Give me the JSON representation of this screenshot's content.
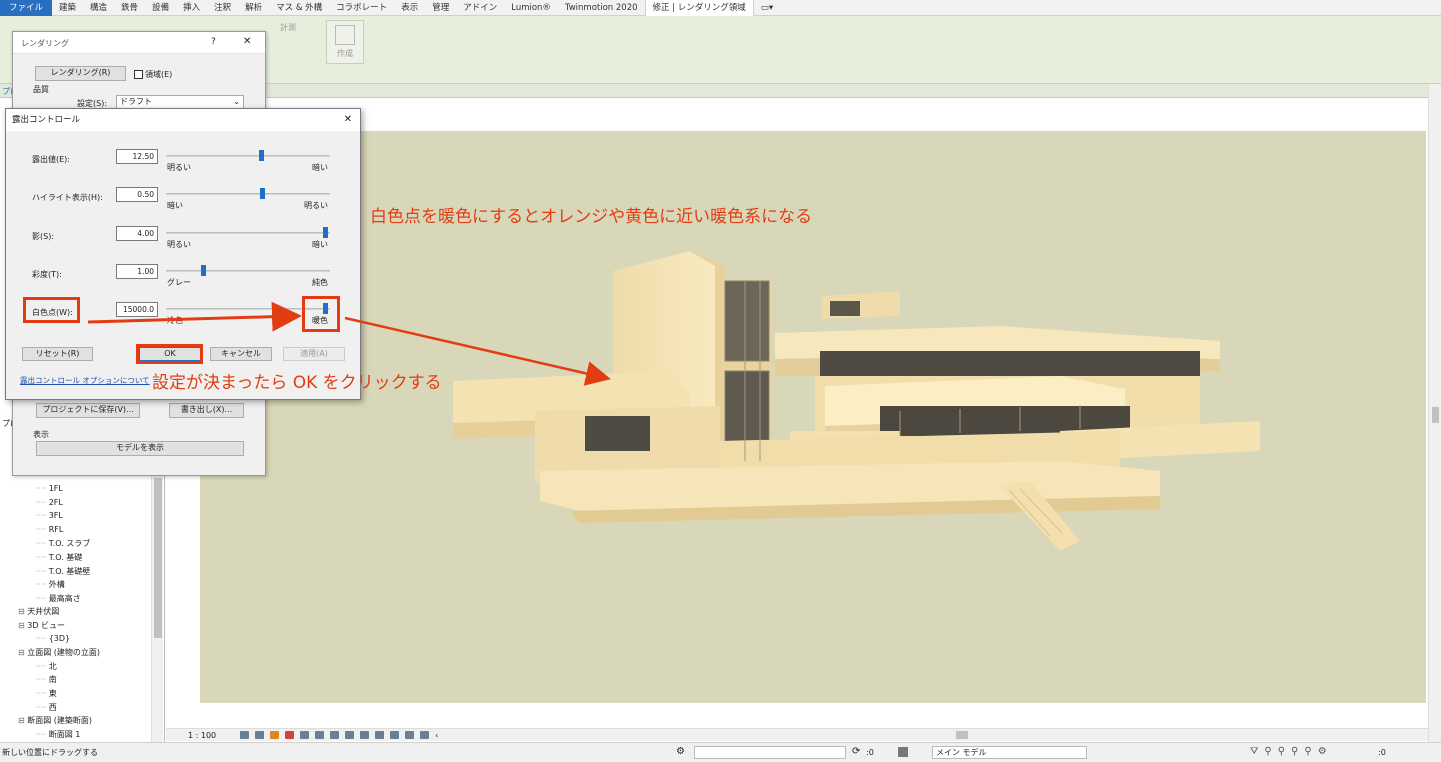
{
  "menubar": {
    "items": [
      "ファイル",
      "建築",
      "構造",
      "鉄骨",
      "設備",
      "挿入",
      "注釈",
      "解析",
      "マス & 外構",
      "コラボレート",
      "表示",
      "管理",
      "アドイン",
      "Lumion®",
      "Twinmotion 2020",
      "修正 | レンダリング領域"
    ],
    "extra": "▭▾"
  },
  "ribbon": {
    "measure_label": "計測",
    "create_label": "作成"
  },
  "left_panel": {
    "tree": [
      "1FL",
      "2FL",
      "3FL",
      "RFL",
      "T.O. スラブ",
      "T.O. 基礎",
      "T.O. 基礎壁",
      "外構",
      "最高高さ"
    ],
    "groups": [
      {
        "label": "天井伏図",
        "children": []
      },
      {
        "label": "3D ビュー",
        "children": [
          "{3D}"
        ]
      },
      {
        "label": "立面図 (建物の立面)",
        "children": [
          "北",
          "南",
          "東",
          "西"
        ]
      },
      {
        "label": "断面図 (建築断面)",
        "children": [
          "断面図 1"
        ]
      }
    ],
    "frag_a": "プロ",
    "frag_b": "プロ"
  },
  "render_dialog": {
    "title": "レンダリング",
    "help": "?",
    "close": "✕",
    "render_button": "レンダリング(R)",
    "region_checkbox": "領域(E)",
    "quality_label": "品質",
    "setting_label": "設定(S):",
    "setting_value": "ドラフト",
    "save_project_button": "プロジェクトに保存(V)...",
    "export_button": "書き出し(X)...",
    "display_label": "表示",
    "show_model_button": "モデルを表示"
  },
  "exposure_dialog": {
    "title": "露出コントロール",
    "close": "✕",
    "rows": [
      {
        "label": "露出値(E):",
        "value": "12.50",
        "left": "明るい",
        "right": "暗い",
        "pos": 0.58
      },
      {
        "label": "ハイライト表示(H):",
        "value": "0.50",
        "left": "暗い",
        "right": "明るい",
        "pos": 0.59
      },
      {
        "label": "影(S):",
        "value": "4.00",
        "left": "明るい",
        "right": "暗い",
        "pos": 0.98
      },
      {
        "label": "彩度(T):",
        "value": "1.00",
        "left": "グレー",
        "right": "純色",
        "pos": 0.22
      },
      {
        "label": "白色点(W):",
        "value": "15000.0",
        "left": "冷色",
        "right": "暖色",
        "pos": 0.98
      }
    ],
    "reset_button": "リセット(R)",
    "ok_button": "OK",
    "cancel_button": "キャンセル",
    "apply_button": "適用(A)",
    "help_link": "露出コントロール オプションについて"
  },
  "annotations": {
    "top": "白色点を暖色にするとオレンジや黄色に近い暖色系になる",
    "bottom": "設定が決まったら OK をクリックする",
    "color": "#e23d12"
  },
  "view_control": {
    "scale": "1 : 100"
  },
  "statusbar": {
    "message": "新しい位置にドラッグする",
    "coord": ":0",
    "model": "メイン モデル",
    "filter": ":0"
  },
  "colors": {
    "render_background": "#d9d7b9",
    "building": "#f5e3b0",
    "ribbon": "#e7efdc",
    "accent": "#1f6fc2"
  }
}
